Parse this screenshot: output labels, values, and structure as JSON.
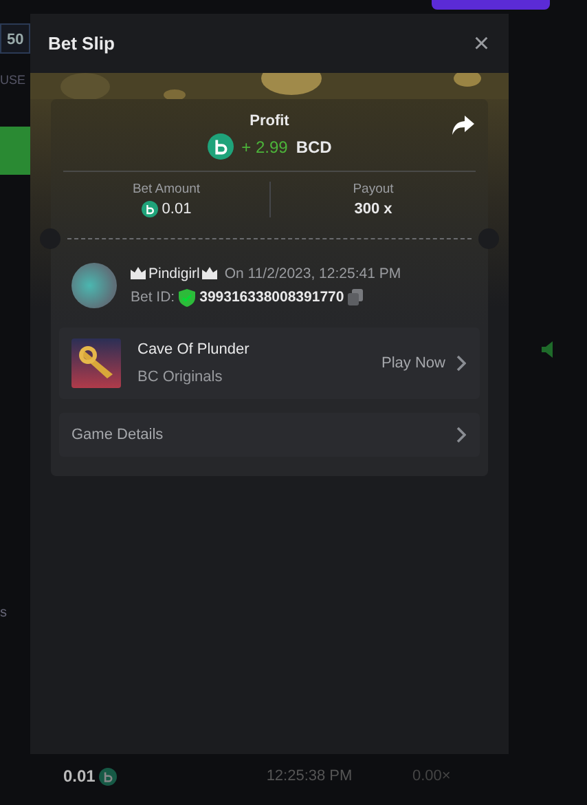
{
  "background": {
    "badge": "50",
    "caption": "USE",
    "side_text": "s",
    "last_row": {
      "amount": "0.01",
      "time": "12:25:38 PM",
      "payout": "0.00×"
    }
  },
  "modal": {
    "title": "Bet Slip",
    "close": "×",
    "profit": {
      "label": "Profit",
      "amount": "+ 2.99",
      "currency": "BCD"
    },
    "bet_amount": {
      "label": "Bet Amount",
      "value": "0.01"
    },
    "payout": {
      "label": "Payout",
      "value": "300 x"
    },
    "player": {
      "name": "Pindigirl",
      "date": "On 11/2/2023, 12:25:41 PM",
      "bet_id_label": "Bet ID:",
      "bet_id": "399316338008391770",
      "verified": true
    },
    "game": {
      "name": "Cave Of Plunder",
      "provider": "BC Originals",
      "action": "Play Now"
    },
    "details": {
      "label": "Game Details"
    }
  }
}
